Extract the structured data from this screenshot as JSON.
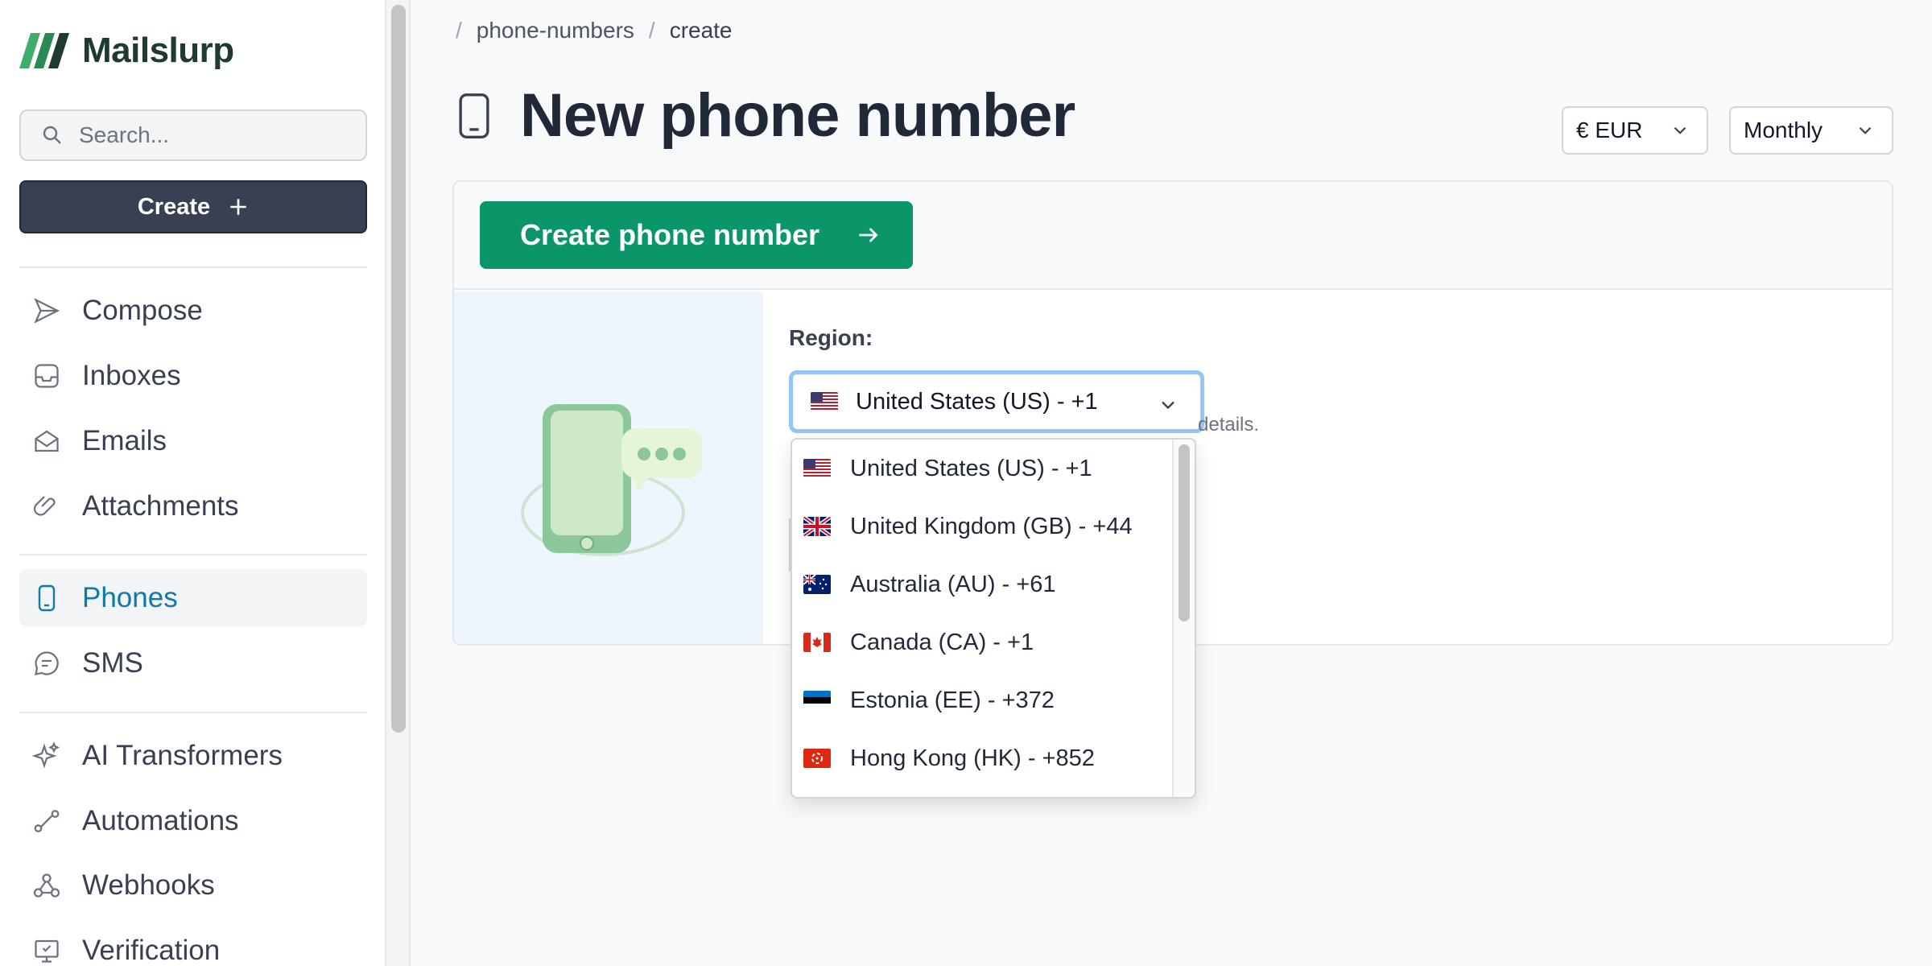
{
  "sidebar": {
    "logo_text": "Mailslurp",
    "search_placeholder": "Search...",
    "create_label": "Create",
    "items": [
      {
        "label": "Compose",
        "icon": "send-icon"
      },
      {
        "label": "Inboxes",
        "icon": "inbox-icon"
      },
      {
        "label": "Emails",
        "icon": "envelope-icon"
      },
      {
        "label": "Attachments",
        "icon": "paperclip-icon"
      },
      {
        "label": "Phones",
        "icon": "phone-icon",
        "active": true
      },
      {
        "label": "SMS",
        "icon": "chat-icon"
      },
      {
        "label": "AI Transformers",
        "icon": "sparkles-icon"
      },
      {
        "label": "Automations",
        "icon": "route-icon"
      },
      {
        "label": "Webhooks",
        "icon": "webhook-icon"
      },
      {
        "label": "Verification",
        "icon": "monitor-check-icon"
      }
    ]
  },
  "breadcrumb": {
    "sep": "/",
    "items": [
      "phone-numbers",
      "create"
    ]
  },
  "page": {
    "title": "New phone number",
    "currency": "€ EUR",
    "period": "Monthly"
  },
  "card": {
    "create_button": "Create phone number",
    "region_label": "Region:",
    "selected_region": "United States (US) - +1",
    "helper_fragment": "details."
  },
  "region_options": [
    {
      "label": "United States (US) - +1",
      "flag": "us"
    },
    {
      "label": "United Kingdom (GB) - +44",
      "flag": "gb"
    },
    {
      "label": "Australia (AU) - +61",
      "flag": "au"
    },
    {
      "label": "Canada (CA) - +1",
      "flag": "ca"
    },
    {
      "label": "Estonia (EE) - +372",
      "flag": "ee"
    },
    {
      "label": "Hong Kong (HK) - +852",
      "flag": "hk"
    }
  ],
  "colors": {
    "brand_green": "#0b9669",
    "active_blue": "#0e7aa8",
    "focus_ring": "#93c5f5"
  }
}
